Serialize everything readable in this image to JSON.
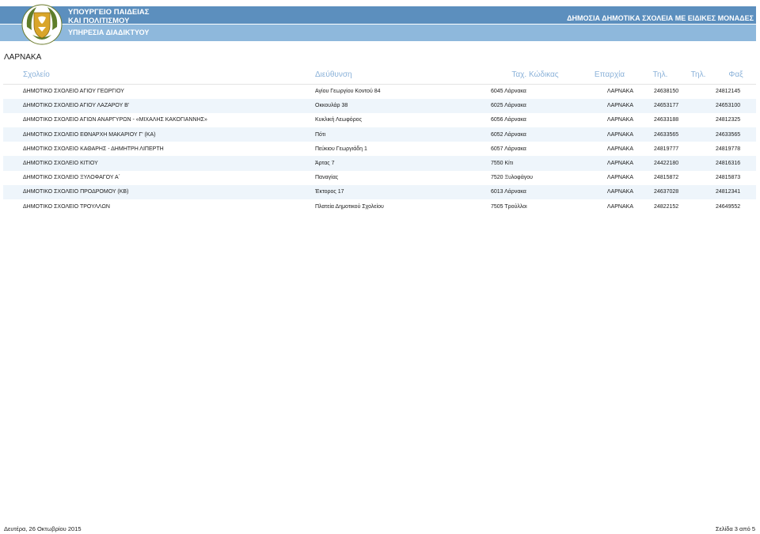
{
  "header": {
    "ministry_line1": "ΥΠΟΥΡΓΕΙΟ ΠΑΙΔΕΙΑΣ",
    "ministry_line2": "ΚΑΙ ΠΟΛΙΤΙΣΜΟΥ",
    "service": "ΥΠΗΡΕΣΙΑ ΔΙΑΔΙΚΤΥΟΥ",
    "title": "ΔΗΜΟΣΙΑ ΔΗΜΟΤΙΚΑ ΣΧΟΛΕΙΑ ΜΕ ΕΙΔΙΚΕΣ ΜΟΝΑΔΕΣ",
    "bar_top_color": "#5c8fbe",
    "bar_bottom_color": "#8eb8dc"
  },
  "region": "ΛΑΡΝΑΚΑ",
  "table": {
    "headers": [
      "Σχολείο",
      "Διεύθυνση",
      "Ταχ. Κώδικας",
      "Επαρχία",
      "Τηλ.",
      "Τηλ.",
      "Φαξ"
    ],
    "rows": [
      [
        "ΔΗΜΟΤΙΚΟ ΣΧΟΛΕΙΟ ΑΓΙΟΥ ΓΕΩΡΓΙΟΥ",
        "Αγίου Γεωργίου Κοντού 84",
        "6045 Λάρνακα",
        "ΛΑΡΝΑΚΑ",
        "24638150",
        "",
        "24812145"
      ],
      [
        "ΔΗΜΟΤΙΚΟ ΣΧΟΛΕΙΟ ΑΓΙΟΥ ΛΑΖΑΡΟΥ Β'",
        "Οκκουλάρ 38",
        "6025 Λάρνακα",
        "ΛΑΡΝΑΚΑ",
        "24653177",
        "",
        "24653100"
      ],
      [
        "ΔΗΜΟΤΙΚΟ ΣΧΟΛΕΙΟ ΑΓΙΩΝ ΑΝΑΡΓΥΡΩΝ - «ΜΙΧΑΛΗΣ ΚΑΚΟΓΙΑΝΝΗΣ»",
        "Κυκλική Λεωφόρος",
        "6056 Λάρνακα",
        "ΛΑΡΝΑΚΑ",
        "24633188",
        "",
        "24812325"
      ],
      [
        "ΔΗΜΟΤΙΚΟ ΣΧΟΛΕΙΟ ΕΘΝΑΡΧΗ ΜΑΚΑΡΙΟΥ Γ' (ΚΑ)",
        "Πότι",
        "6052 Λάρνακα",
        "ΛΑΡΝΑΚΑ",
        "24633565",
        "",
        "24633565"
      ],
      [
        "ΔΗΜΟΤΙΚΟ ΣΧΟΛΕΙΟ ΚΑΘΑΡΗΣ - ΔΗΜΗΤΡΗ ΛΙΠΕΡΤΗ",
        "Πεύκιου Γεωργιάδη 1",
        "6057 Λάρνακα",
        "ΛΑΡΝΑΚΑ",
        "24819777",
        "",
        "24819778"
      ],
      [
        "ΔΗΜΟΤΙΚΟ ΣΧΟΛΕΙΟ ΚΙΤΙΟΥ",
        "Άρτας 7",
        "7550 Κίτι",
        "ΛΑΡΝΑΚΑ",
        "24422180",
        "",
        "24816316"
      ],
      [
        "ΔΗΜΟΤΙΚΟ ΣΧΟΛΕΙΟ ΞΥΛΟΦΑΓΟΥ Α΄",
        "Παναγίας",
        "7520 Ξυλοφάγου",
        "ΛΑΡΝΑΚΑ",
        "24815872",
        "",
        "24815873"
      ],
      [
        "ΔΗΜΟΤΙΚΟ ΣΧΟΛΕΙΟ ΠΡΟΔΡΟΜΟΥ (ΚΒ)",
        "Έκτορος 17",
        "6013 Λάρνακα",
        "ΛΑΡΝΑΚΑ",
        "24637028",
        "",
        "24812341"
      ],
      [
        "ΔΗΜΟΤΙΚΟ ΣΧΟΛΕΙΟ ΤΡΟΥΛΛΩΝ",
        "Πλατεία Δημοτικού Σχολείου",
        "7505 Τρούλλοι",
        "ΛΑΡΝΑΚΑ",
        "24822152",
        "",
        "24649552"
      ]
    ]
  },
  "footer": {
    "date": "Δευτέρα, 26 Οκτωβρίου 2015",
    "page": "Σελίδα 3 από 5"
  }
}
